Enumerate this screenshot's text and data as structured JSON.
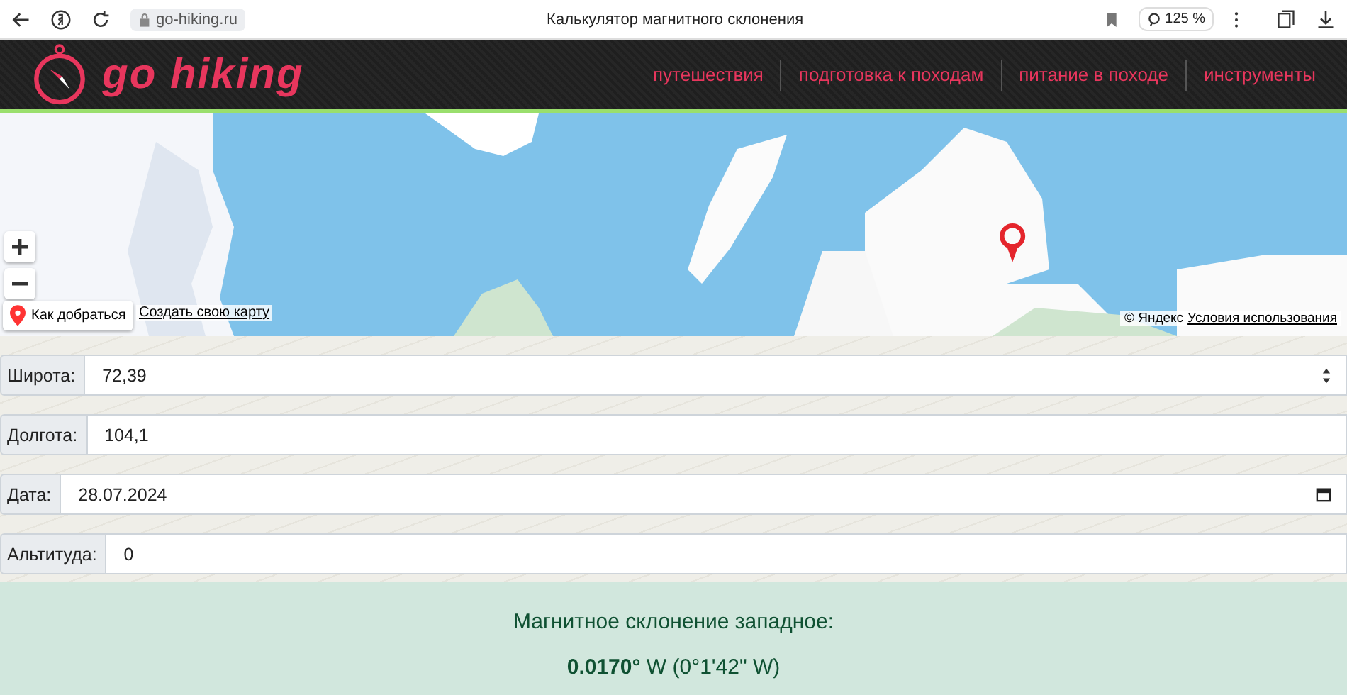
{
  "browser": {
    "url": "go-hiking.ru",
    "title": "Калькулятор магнитного склонения",
    "zoom": "125 %"
  },
  "header": {
    "logo": "go hiking",
    "nav": [
      "путешествия",
      "подготовка к походам",
      "питание в походе",
      "инструменты"
    ]
  },
  "map": {
    "route_button": "Как добраться",
    "create_link": "Создать свою карту",
    "copyright": "© Яндекс",
    "terms": "Условия использования"
  },
  "form": {
    "fields": [
      {
        "label": "Широта:",
        "value": "72,39",
        "kind": "number"
      },
      {
        "label": "Долгота:",
        "value": "104,1",
        "kind": "text"
      },
      {
        "label": "Дата:",
        "value": "28.07.2024",
        "kind": "date"
      },
      {
        "label": "Альтитуда:",
        "value": "0",
        "kind": "text"
      }
    ]
  },
  "result": {
    "title": "Магнитное склонение западное:",
    "value": "**0.0170°** W (0°1'42\" W)"
  }
}
